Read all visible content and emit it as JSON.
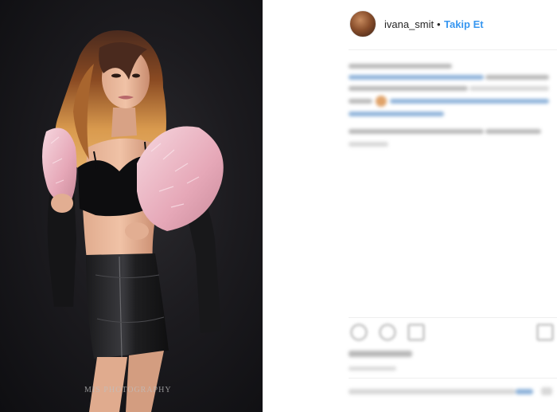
{
  "post": {
    "username": "ivana_smit",
    "separator": "•",
    "follow_label": "Takip Et",
    "avatar_icon": "profile-avatar",
    "watermark": "MIS PHOTOGRAPHY",
    "colors": {
      "follow": "#3897f0",
      "text": "#262626",
      "photo_background": "#1c1b1f"
    }
  }
}
